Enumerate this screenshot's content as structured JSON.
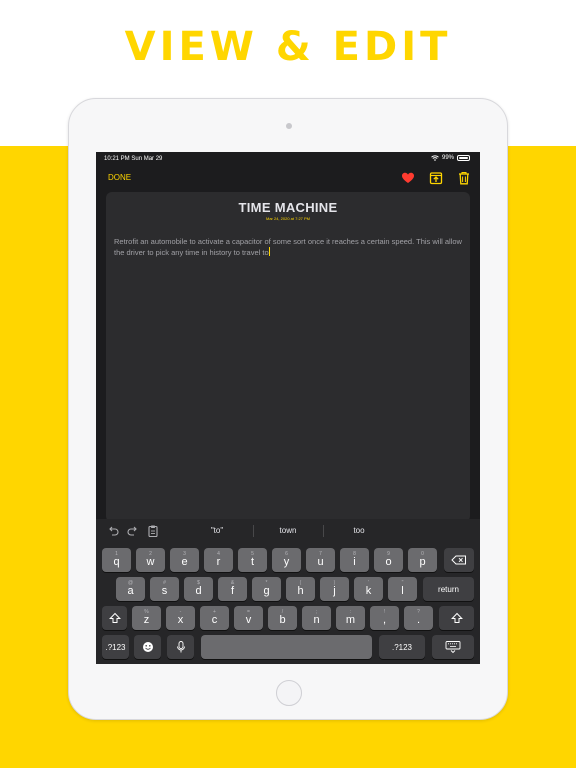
{
  "headline": "VIEW & EDIT",
  "status": {
    "time": "10:21 PM  Sun Mar 29",
    "battery": "99%",
    "battery_level": 0.99
  },
  "nav": {
    "done_label": "DONE"
  },
  "note": {
    "title": "TIME MACHINE",
    "date": "Mar 24, 2020 at 7:27 PM",
    "body": "Retrofit an automobile to activate a capacitor of some sort once it reaches a certain speed. This will allow the driver to pick any time in history to travel to"
  },
  "suggestions": [
    "\"to\"",
    "town",
    "too"
  ],
  "keyboard": {
    "row1": [
      {
        "main": "q",
        "alt": "1"
      },
      {
        "main": "w",
        "alt": "2"
      },
      {
        "main": "e",
        "alt": "3"
      },
      {
        "main": "r",
        "alt": "4"
      },
      {
        "main": "t",
        "alt": "5"
      },
      {
        "main": "y",
        "alt": "6"
      },
      {
        "main": "u",
        "alt": "7"
      },
      {
        "main": "i",
        "alt": "8"
      },
      {
        "main": "o",
        "alt": "9"
      },
      {
        "main": "p",
        "alt": "0"
      }
    ],
    "row2": [
      {
        "main": "a",
        "alt": "@"
      },
      {
        "main": "s",
        "alt": "#"
      },
      {
        "main": "d",
        "alt": "$"
      },
      {
        "main": "f",
        "alt": "&"
      },
      {
        "main": "g",
        "alt": "*"
      },
      {
        "main": "h",
        "alt": "("
      },
      {
        "main": "j",
        "alt": ")"
      },
      {
        "main": "k",
        "alt": "'"
      },
      {
        "main": "l",
        "alt": "\""
      }
    ],
    "row3": [
      {
        "main": "z",
        "alt": "%"
      },
      {
        "main": "x",
        "alt": "-"
      },
      {
        "main": "c",
        "alt": "+"
      },
      {
        "main": "v",
        "alt": "="
      },
      {
        "main": "b",
        "alt": "/"
      },
      {
        "main": "n",
        "alt": ";"
      },
      {
        "main": "m",
        "alt": ":"
      },
      {
        "main": ",",
        "alt": "!"
      },
      {
        "main": ".",
        "alt": "?"
      }
    ],
    "return_label": "return",
    "numbers_label": ".?123"
  },
  "colors": {
    "accent": "#FFD600",
    "heart": "#FF3B30",
    "screen": "#1c1c1e",
    "card": "#2c2c2e"
  }
}
